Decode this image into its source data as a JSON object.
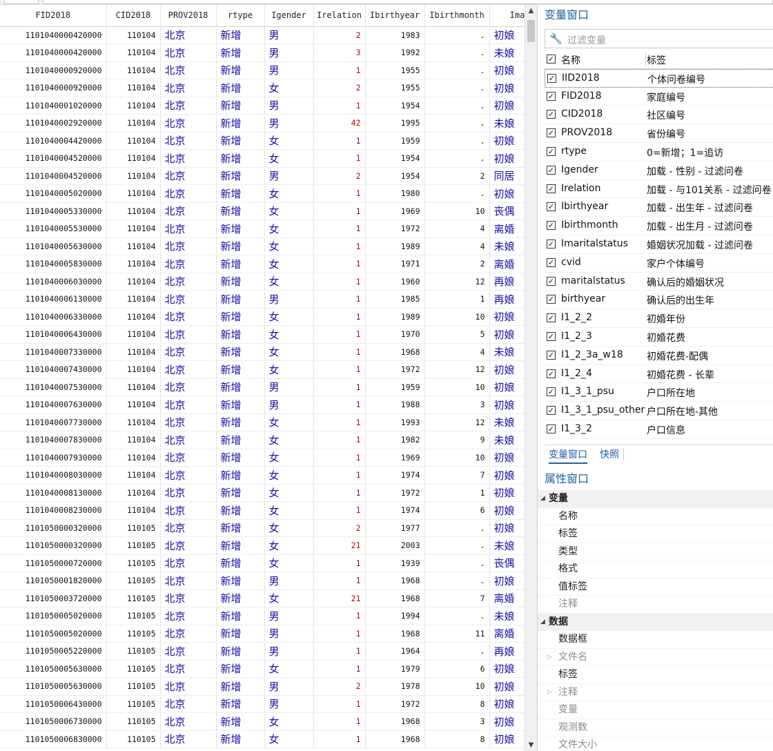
{
  "grid": {
    "columns": [
      "FID2018",
      "CID2018",
      "PROV2018",
      "rtype",
      "Igender",
      "Irelation",
      "Ibirthyear",
      "Ibirthmonth",
      "Ima"
    ],
    "rows": [
      [
        "1101040000420000",
        "110104",
        "北京",
        "新增",
        "男",
        "2",
        "1983",
        ".",
        "初娘"
      ],
      [
        "1101040000420000",
        "110104",
        "北京",
        "新增",
        "男",
        "3",
        "1992",
        ".",
        "未娘"
      ],
      [
        "1101040000920000",
        "110104",
        "北京",
        "新增",
        "男",
        "1",
        "1955",
        ".",
        "初娘"
      ],
      [
        "1101040000920000",
        "110104",
        "北京",
        "新增",
        "女",
        "2",
        "1955",
        ".",
        "初娘"
      ],
      [
        "1101040001020000",
        "110104",
        "北京",
        "新增",
        "男",
        "1",
        "1954",
        ".",
        "初娘"
      ],
      [
        "1101040002920000",
        "110104",
        "北京",
        "新增",
        "男",
        "42",
        "1995",
        ".",
        "未娘"
      ],
      [
        "1101040004420000",
        "110104",
        "北京",
        "新增",
        "女",
        "1",
        "1959",
        ".",
        "初娘"
      ],
      [
        "1101040004520000",
        "110104",
        "北京",
        "新增",
        "女",
        "1",
        "1954",
        ".",
        "初娘"
      ],
      [
        "1101040004520000",
        "110104",
        "北京",
        "新增",
        "男",
        "2",
        "1954",
        "2",
        "同居"
      ],
      [
        "1101040005020000",
        "110104",
        "北京",
        "新增",
        "女",
        "1",
        "1980",
        ".",
        "初娘"
      ],
      [
        "1101040005330000",
        "110104",
        "北京",
        "新增",
        "女",
        "1",
        "1969",
        "10",
        "丧偶"
      ],
      [
        "1101040005530000",
        "110104",
        "北京",
        "新增",
        "女",
        "1",
        "1972",
        "4",
        "离婚"
      ],
      [
        "1101040005630000",
        "110104",
        "北京",
        "新增",
        "女",
        "1",
        "1989",
        "4",
        "未娘"
      ],
      [
        "1101040005830000",
        "110104",
        "北京",
        "新增",
        "女",
        "1",
        "1971",
        "2",
        "离婚"
      ],
      [
        "1101040006030000",
        "110104",
        "北京",
        "新增",
        "女",
        "1",
        "1960",
        "12",
        "再娘"
      ],
      [
        "1101040006130000",
        "110104",
        "北京",
        "新增",
        "男",
        "1",
        "1985",
        "1",
        "再娘"
      ],
      [
        "1101040006330000",
        "110104",
        "北京",
        "新增",
        "女",
        "1",
        "1989",
        "10",
        "初娘"
      ],
      [
        "1101040006430000",
        "110104",
        "北京",
        "新增",
        "女",
        "1",
        "1970",
        "5",
        "初娘"
      ],
      [
        "1101040007330000",
        "110104",
        "北京",
        "新增",
        "女",
        "1",
        "1968",
        "4",
        "未娘"
      ],
      [
        "1101040007430000",
        "110104",
        "北京",
        "新增",
        "女",
        "1",
        "1972",
        "12",
        "初娘"
      ],
      [
        "1101040007530000",
        "110104",
        "北京",
        "新增",
        "男",
        "1",
        "1959",
        "10",
        "初娘"
      ],
      [
        "1101040007630000",
        "110104",
        "北京",
        "新增",
        "男",
        "1",
        "1988",
        "3",
        "初娘"
      ],
      [
        "1101040007730000",
        "110104",
        "北京",
        "新增",
        "女",
        "1",
        "1993",
        "12",
        "未娘"
      ],
      [
        "1101040007830000",
        "110104",
        "北京",
        "新增",
        "女",
        "1",
        "1982",
        "9",
        "未娘"
      ],
      [
        "1101040007930000",
        "110104",
        "北京",
        "新增",
        "女",
        "1",
        "1969",
        "10",
        "初娘"
      ],
      [
        "1101040008030000",
        "110104",
        "北京",
        "新增",
        "女",
        "1",
        "1974",
        "7",
        "初娘"
      ],
      [
        "1101040008130000",
        "110104",
        "北京",
        "新增",
        "女",
        "1",
        "1972",
        "1",
        "初娘"
      ],
      [
        "1101040008230000",
        "110104",
        "北京",
        "新增",
        "女",
        "1",
        "1974",
        "6",
        "初娘"
      ],
      [
        "1101050000320000",
        "110105",
        "北京",
        "新增",
        "女",
        "2",
        "1977",
        ".",
        "初娘"
      ],
      [
        "1101050000320000",
        "110105",
        "北京",
        "新增",
        "女",
        "21",
        "2003",
        ".",
        "未娘"
      ],
      [
        "1101050000720000",
        "110105",
        "北京",
        "新增",
        "女",
        "1",
        "1939",
        ".",
        "丧偶"
      ],
      [
        "1101050001820000",
        "110105",
        "北京",
        "新增",
        "男",
        "1",
        "1968",
        ".",
        "初娘"
      ],
      [
        "1101050003720000",
        "110105",
        "北京",
        "新增",
        "女",
        "21",
        "1968",
        "7",
        "离婚"
      ],
      [
        "1101050005020000",
        "110105",
        "北京",
        "新增",
        "男",
        "1",
        "1994",
        ".",
        "未娘"
      ],
      [
        "1101050005020000",
        "110105",
        "北京",
        "新增",
        "男",
        "1",
        "1968",
        "11",
        "离婚"
      ],
      [
        "1101050005220000",
        "110105",
        "北京",
        "新增",
        "男",
        "1",
        "1964",
        ".",
        "再娘"
      ],
      [
        "1101050005630000",
        "110105",
        "北京",
        "新增",
        "女",
        "1",
        "1979",
        "6",
        "初娘"
      ],
      [
        "1101050005630000",
        "110105",
        "北京",
        "新增",
        "男",
        "2",
        "1978",
        "10",
        "初娘"
      ],
      [
        "1101050006430000",
        "110105",
        "北京",
        "新增",
        "男",
        "1",
        "1972",
        "8",
        "初娘"
      ],
      [
        "1101050006730000",
        "110105",
        "北京",
        "新增",
        "女",
        "1",
        "1968",
        "3",
        "初娘"
      ],
      [
        "1101050006830000",
        "110105",
        "北京",
        "新增",
        "女",
        "1",
        "1968",
        "8",
        "初娘"
      ]
    ]
  },
  "variables_window": {
    "title": "变量窗口",
    "filter_placeholder": "过滤变量",
    "header_name": "名称",
    "header_label": "标签",
    "items": [
      {
        "name": "IID2018",
        "label": "个体问卷编号"
      },
      {
        "name": "FID2018",
        "label": "家庭编号"
      },
      {
        "name": "CID2018",
        "label": "社区编号"
      },
      {
        "name": "PROV2018",
        "label": "省份编号"
      },
      {
        "name": "rtype",
        "label": "0=新增；1=追访"
      },
      {
        "name": "Igender",
        "label": "加载 - 性别 - 过滤问卷"
      },
      {
        "name": "Irelation",
        "label": "加载 - 与101关系 - 过滤问卷"
      },
      {
        "name": "Ibirthyear",
        "label": "加载 - 出生年 - 过滤问卷"
      },
      {
        "name": "Ibirthmonth",
        "label": "加载 - 出生月 - 过滤问卷"
      },
      {
        "name": "Imaritalstatus",
        "label": "婚姻状况加载 - 过滤问卷"
      },
      {
        "name": "cvid",
        "label": "家户个体编号"
      },
      {
        "name": "maritalstatus",
        "label": "确认后的婚姻状况"
      },
      {
        "name": "birthyear",
        "label": "确认后的出生年"
      },
      {
        "name": "I1_2_2",
        "label": "初婚年份"
      },
      {
        "name": "I1_2_3",
        "label": "初婚花费"
      },
      {
        "name": "I1_2_3a_w18",
        "label": "初婚花费-配偶"
      },
      {
        "name": "I1_2_4",
        "label": "初婚花费 - 长辈"
      },
      {
        "name": "I1_3_1_psu",
        "label": "户口所在地"
      },
      {
        "name": "I1_3_1_psu_other",
        "label": "户口所在地-其他"
      },
      {
        "name": "I1_3_2",
        "label": "户口信息"
      }
    ],
    "tabs": [
      "变量窗口",
      "快照"
    ]
  },
  "properties_window": {
    "title": "属性窗口",
    "groups": [
      {
        "title": "变量",
        "rows": [
          "名称",
          "标签",
          "类型",
          "格式",
          "值标签",
          "注释"
        ]
      },
      {
        "title": "数据",
        "rows": [
          "数据框",
          "文件名",
          "标签",
          "注释",
          "变量",
          "观测数",
          "文件大小"
        ]
      }
    ]
  }
}
